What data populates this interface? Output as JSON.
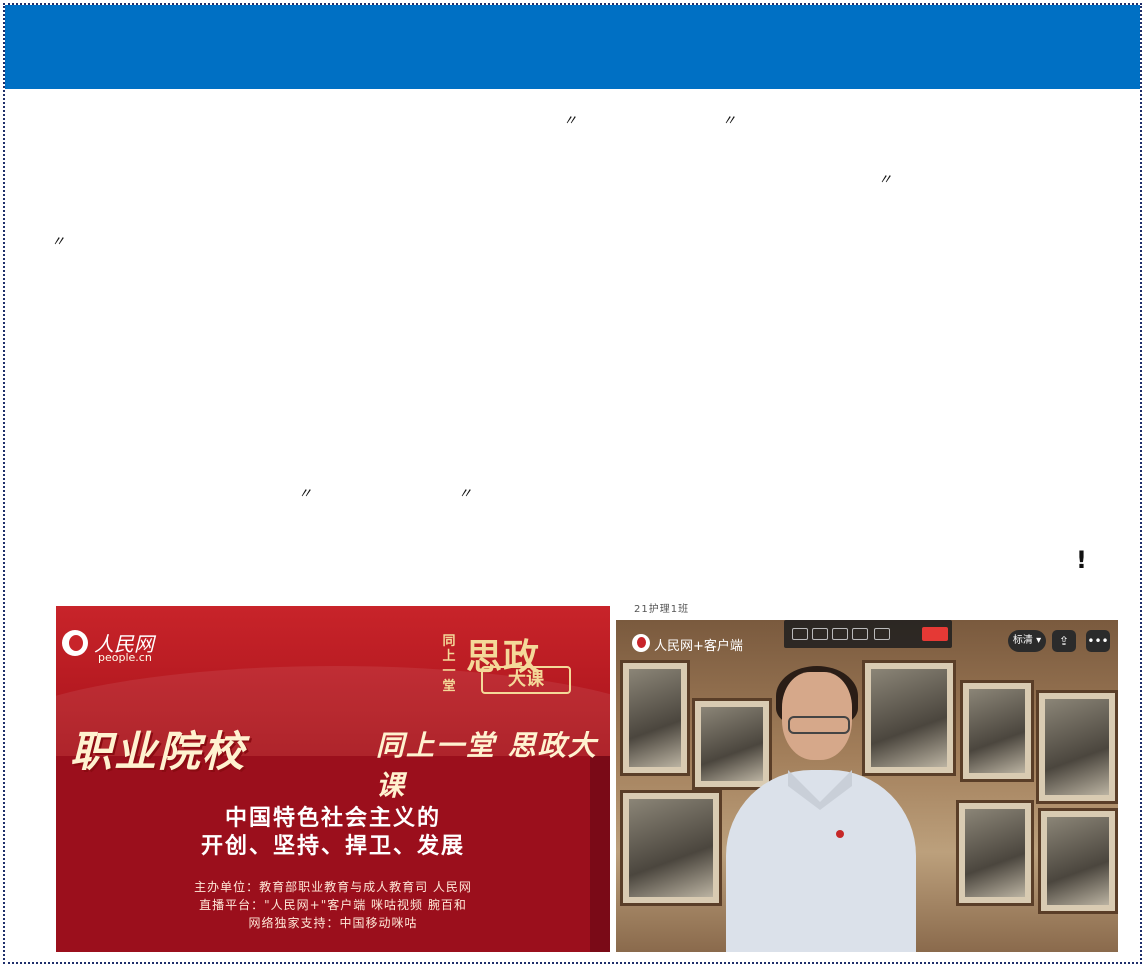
{
  "quotes": {
    "q1_open": "〃",
    "q1_close": "〃",
    "q2_open": "〃",
    "q2_close": "〃",
    "q3_open": "〃",
    "q3_close": "〃"
  },
  "exclamation": "!",
  "left_image": {
    "logo_text": "人民网",
    "logo_sub": "people.cn",
    "brand_small": "同上一堂",
    "brand_big": "思政",
    "brand_box": "大课",
    "headline": "职业院校",
    "headline_sub": "同上一堂 思政大课",
    "title_line1": "中国特色社会主义的",
    "title_line2": "开创、坚持、捍卫、发展",
    "credit_line1": "主办单位：教育部职业教育与成人教育司  人民网",
    "credit_line2": "直播平台：\"人民网+\"客户端  咪咕视频  腕百和",
    "credit_line3": "网络独家支持：中国移动咪咕"
  },
  "right_image": {
    "caption": "21护理1班",
    "app_name": "人民网+客户端",
    "pill_label": "标清 ▾",
    "share_icon_glyph": "⇪",
    "more_icon_glyph": "•••"
  },
  "colors": {
    "header_blue": "#0070c4",
    "frame_border": "#1f2f6b"
  }
}
